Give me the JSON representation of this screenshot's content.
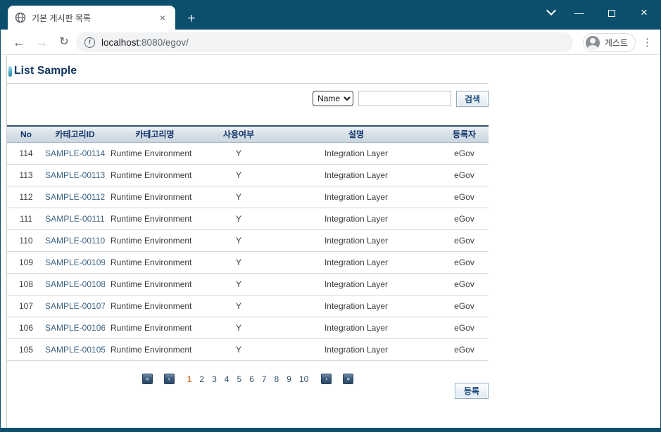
{
  "window": {
    "tab": {
      "title": "기본 게시판 목록",
      "favicon": "globe-icon",
      "close_glyph": "×",
      "new_tab_glyph": "+"
    },
    "controls": {
      "chevron": "chevron-down",
      "minimize": "—",
      "maximize": "square",
      "close": "×"
    },
    "toolbar": {
      "back_glyph": "←",
      "forward_glyph": "→",
      "reload_glyph": "↻",
      "info_glyph": "i",
      "url_host": "localhost",
      "url_rest": ":8080/egov/",
      "profile_label": "게스트",
      "menu_glyph": "⋮"
    }
  },
  "page": {
    "title": "List Sample",
    "search": {
      "select_value": "Name",
      "input_value": "",
      "input_placeholder": "",
      "button_label": "검색"
    },
    "table": {
      "headers": [
        "No",
        "카테고리ID",
        "카테고리명",
        "사용여부",
        "설명",
        "등록자"
      ],
      "rows": [
        {
          "no": "114",
          "id": "SAMPLE-00114",
          "name": "Runtime Environment",
          "use": "Y",
          "desc": "Integration Layer",
          "reg": "eGov"
        },
        {
          "no": "113",
          "id": "SAMPLE-00113",
          "name": "Runtime Environment",
          "use": "Y",
          "desc": "Integration Layer",
          "reg": "eGov"
        },
        {
          "no": "112",
          "id": "SAMPLE-00112",
          "name": "Runtime Environment",
          "use": "Y",
          "desc": "Integration Layer",
          "reg": "eGov"
        },
        {
          "no": "111",
          "id": "SAMPLE-00111",
          "name": "Runtime Environment",
          "use": "Y",
          "desc": "Integration Layer",
          "reg": "eGov"
        },
        {
          "no": "110",
          "id": "SAMPLE-00110",
          "name": "Runtime Environment",
          "use": "Y",
          "desc": "Integration Layer",
          "reg": "eGov"
        },
        {
          "no": "109",
          "id": "SAMPLE-00109",
          "name": "Runtime Environment",
          "use": "Y",
          "desc": "Integration Layer",
          "reg": "eGov"
        },
        {
          "no": "108",
          "id": "SAMPLE-00108",
          "name": "Runtime Environment",
          "use": "Y",
          "desc": "Integration Layer",
          "reg": "eGov"
        },
        {
          "no": "107",
          "id": "SAMPLE-00107",
          "name": "Runtime Environment",
          "use": "Y",
          "desc": "Integration Layer",
          "reg": "eGov"
        },
        {
          "no": "106",
          "id": "SAMPLE-00106",
          "name": "Runtime Environment",
          "use": "Y",
          "desc": "Integration Layer",
          "reg": "eGov"
        },
        {
          "no": "105",
          "id": "SAMPLE-00105",
          "name": "Runtime Environment",
          "use": "Y",
          "desc": "Integration Layer",
          "reg": "eGov"
        }
      ]
    },
    "pagination": {
      "first_glyph": "«",
      "prev_glyph": "‹",
      "next_glyph": "›",
      "last_glyph": "»",
      "pages": [
        "1",
        "2",
        "3",
        "4",
        "5",
        "6",
        "7",
        "8",
        "9",
        "10"
      ],
      "current": "1"
    },
    "register_button": "등록"
  },
  "colors": {
    "frame_teal": "#0b4f6d",
    "title_navy": "#0d3261",
    "header_text_navy": "#14356b",
    "id_link_blue": "#3e6484",
    "current_page_orange": "#c97b3c",
    "pager_button_navy": "#2e4a68",
    "button_face_blue": "#dce9f2"
  }
}
